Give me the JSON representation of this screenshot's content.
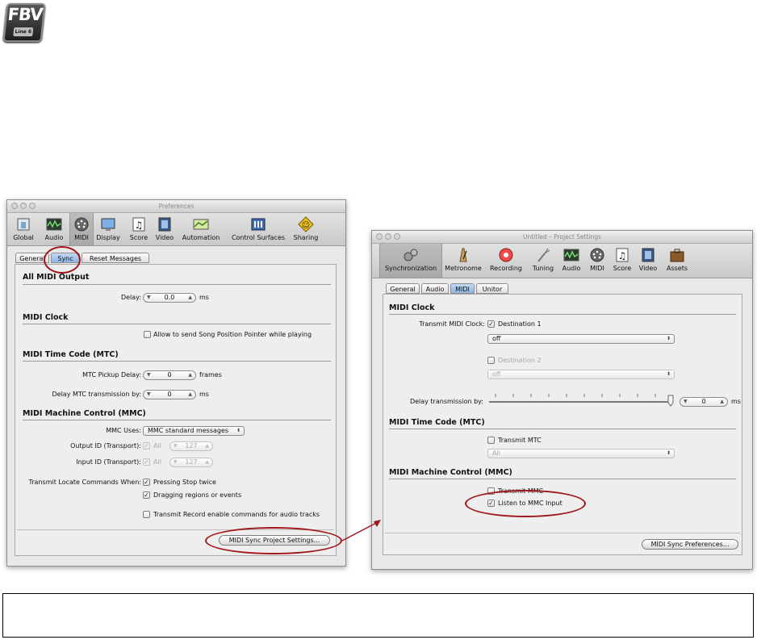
{
  "logo": {
    "text": "FBV",
    "subtext": "Line 6"
  },
  "left_window": {
    "title": "Preferences",
    "toolbar": [
      {
        "label": "Global",
        "icon": "global-icon"
      },
      {
        "label": "Audio",
        "icon": "audio-icon"
      },
      {
        "label": "MIDI",
        "icon": "midi-icon",
        "selected": true
      },
      {
        "label": "Display",
        "icon": "display-icon"
      },
      {
        "label": "Score",
        "icon": "score-icon"
      },
      {
        "label": "Video",
        "icon": "video-icon"
      },
      {
        "label": "Automation",
        "icon": "automation-icon"
      },
      {
        "label": "Control Surfaces",
        "icon": "control-surfaces-icon"
      },
      {
        "label": "Sharing",
        "icon": "sharing-icon"
      }
    ],
    "tabs": [
      "General",
      "Sync",
      "Reset Messages"
    ],
    "selected_tab": "Sync",
    "all_midi_output": {
      "heading": "All MIDI Output",
      "delay_label": "Delay:",
      "delay_value": "0.0",
      "delay_unit": "ms"
    },
    "midi_clock": {
      "heading": "MIDI Clock",
      "spp_label": "Allow to send Song Position Pointer while playing",
      "spp_checked": false
    },
    "mtc": {
      "heading": "MIDI Time Code (MTC)",
      "pickup_label": "MTC Pickup Delay:",
      "pickup_value": "0",
      "pickup_unit": "frames",
      "delay_tx_label": "Delay MTC transmission by:",
      "delay_tx_value": "0",
      "delay_tx_unit": "ms"
    },
    "mmc": {
      "heading": "MIDI Machine Control (MMC)",
      "uses_label": "MMC Uses:",
      "uses_value": "MMC standard messages",
      "output_id_label": "Output ID (Transport):",
      "input_id_label": "Input ID (Transport):",
      "all_label": "All",
      "id_value": "127",
      "locate_label": "Transmit Locate Commands When:",
      "pressing_stop_label": "Pressing Stop twice",
      "dragging_label": "Dragging regions or events",
      "record_enable_label": "Transmit Record enable commands for audio tracks"
    },
    "footer_button": "MIDI Sync Project Settings..."
  },
  "right_window": {
    "title": "Untitled – Project Settings",
    "toolbar": [
      {
        "label": "Synchronization",
        "icon": "synchronization-icon",
        "selected": true
      },
      {
        "label": "Metronome",
        "icon": "metronome-icon"
      },
      {
        "label": "Recording",
        "icon": "recording-icon"
      },
      {
        "label": "Tuning",
        "icon": "tuning-icon"
      },
      {
        "label": "Audio",
        "icon": "audio-icon"
      },
      {
        "label": "MIDI",
        "icon": "midi-icon"
      },
      {
        "label": "Score",
        "icon": "score-icon"
      },
      {
        "label": "Video",
        "icon": "video-icon"
      },
      {
        "label": "Assets",
        "icon": "assets-icon"
      }
    ],
    "tabs": [
      "General",
      "Audio",
      "MIDI",
      "Unitor"
    ],
    "selected_tab": "MIDI",
    "midi_clock": {
      "heading": "MIDI Clock",
      "transmit_label": "Transmit MIDI Clock:",
      "dest1_label": "Destination 1",
      "dest1_value": "off",
      "dest2_label": "Destination 2",
      "dest2_value": "off",
      "delay_label": "Delay transmission by:",
      "delay_value": "0",
      "delay_unit": "ms"
    },
    "mtc": {
      "heading": "MIDI Time Code (MTC)",
      "transmit_label": "Transmit MTC",
      "value": "All"
    },
    "mmc": {
      "heading": "MIDI Machine Control (MMC)",
      "transmit_label": "Transmit MMC",
      "listen_label": "Listen to MMC Input"
    },
    "footer_button": "MIDI Sync Preferences..."
  }
}
